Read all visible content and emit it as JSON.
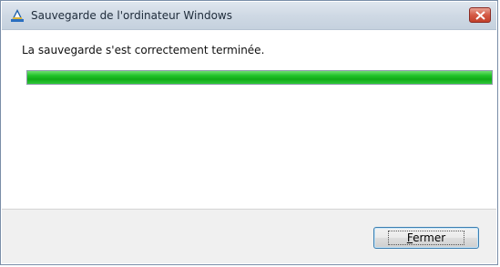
{
  "window": {
    "title": "Sauvegarde de l'ordinateur Windows",
    "title_icon": "backup-icon",
    "close_icon": "close-icon"
  },
  "main": {
    "message": "La sauvegarde s'est correctement terminée.",
    "progress_fraction": 1.0,
    "progress_color": "#22c32a"
  },
  "footer": {
    "close_button_mnemonic": "F",
    "close_button_rest": "ermer"
  },
  "colors": {
    "titlebar": "#cfd9e4",
    "close_button_red": "#d45a45",
    "footer_bg": "#f0f0f0",
    "default_button_border": "#3c7fb1"
  }
}
